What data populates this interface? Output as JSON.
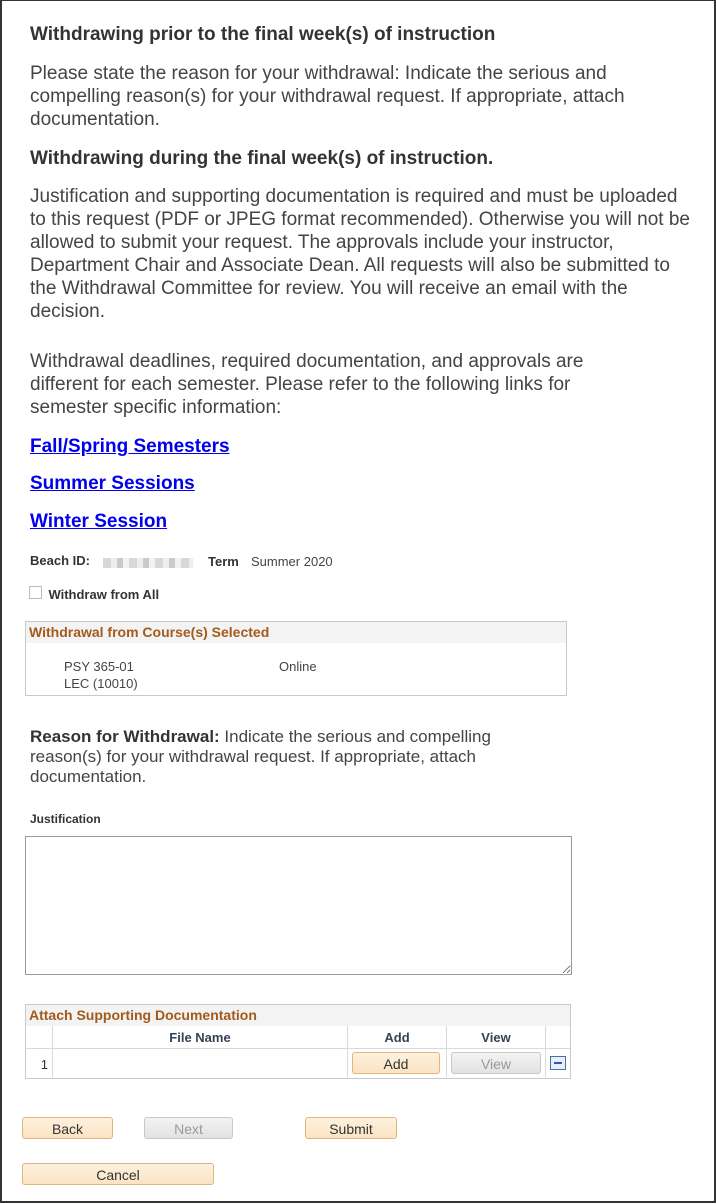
{
  "intro": {
    "heading_prior": "Withdrawing prior to the final week(s) of instruction",
    "text_prior": "Please state the reason for your withdrawal: Indicate the serious and compelling reason(s) for your withdrawal request. If appropriate, attach documentation.",
    "heading_final": "Withdrawing during the final week(s) of instruction.",
    "text_final": "Justification and supporting documentation is required and must be uploaded to this request (PDF or JPEG format recommended). Otherwise you will not be allowed to submit your request. The approvals include your instructor, Department Chair and Associate Dean. All requests will also be submitted to the Withdrawal Committee for review. You will receive an email with the decision.",
    "text_deadlines": "Withdrawal deadlines, required documentation, and approvals are different for each semester. Please refer to the following links for semester specific information:"
  },
  "links": [
    "Fall/Spring Semesters",
    "Summer Sessions",
    "Winter Session"
  ],
  "student": {
    "beach_id_label": "Beach ID:",
    "term_label": "Term",
    "term_value": "Summer 2020"
  },
  "withdraw_all": {
    "label": "Withdraw from All",
    "checked": false
  },
  "courses_group": {
    "title": "Withdrawal from Course(s) Selected",
    "courses": [
      {
        "code": "PSY 365-01",
        "section": "LEC (10010)",
        "mode": "Online"
      }
    ]
  },
  "reason": {
    "label": "Reason for Withdrawal:",
    "text": " Indicate the serious and compelling reason(s) for your withdrawal request. If appropriate, attach documentation."
  },
  "justification": {
    "label": "Justification",
    "value": ""
  },
  "attachments": {
    "title": "Attach Supporting Documentation",
    "columns": [
      "File Name",
      "Add",
      "View"
    ],
    "rows": [
      {
        "num": "1",
        "file_name": "",
        "add_label": "Add",
        "view_label": "View"
      }
    ]
  },
  "buttons": {
    "back": "Back",
    "next": "Next",
    "submit": "Submit",
    "cancel": "Cancel"
  }
}
